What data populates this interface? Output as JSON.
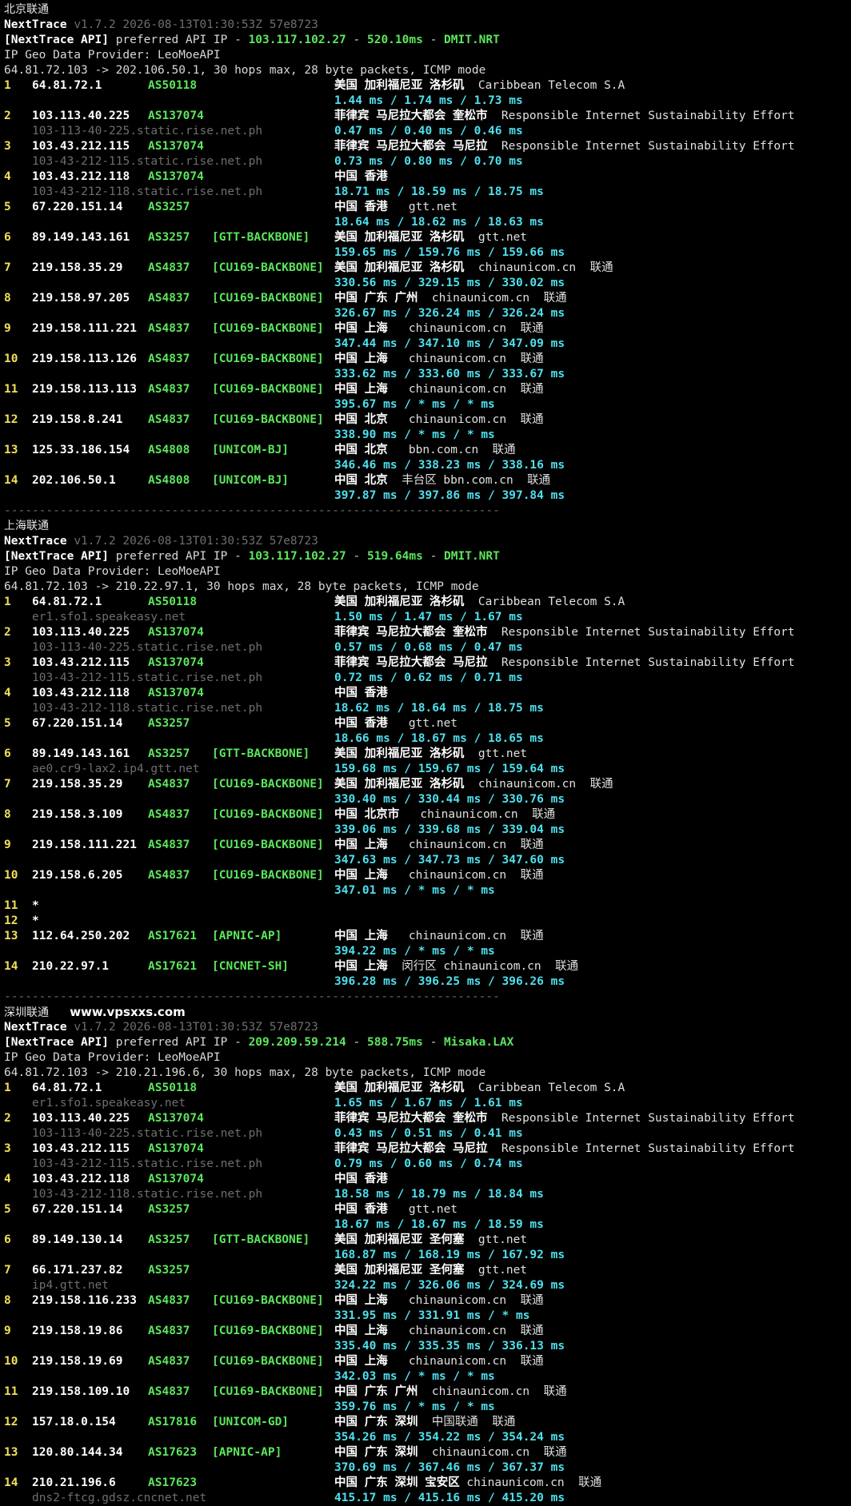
{
  "blocks": [
    {
      "title": "北京联通",
      "watermark": "",
      "header": {
        "brand": "NextTrace",
        "version": "v1.7.2 2026-08-13T01:30:53Z 57e8723",
        "api_label": "[NextTrace API]",
        "api_pref": "preferred API IP -",
        "api_ip": "103.117.102.27",
        "api_dash": "-",
        "api_ms": "520.10ms",
        "api_dc": "DMIT.NRT",
        "geo_provider": "IP Geo Data Provider: LeoMoeAPI",
        "target": "64.81.72.103 -> 202.106.50.1, 30 hops max, 28 byte packets, ICMP mode"
      },
      "hops": [
        {
          "n": "1",
          "ip": "64.81.72.1",
          "as": "AS50118",
          "tag": "",
          "geo": "美国 加利福尼亚 洛杉矶  Caribbean Telecom S.A",
          "rdns": "",
          "rtt": "1.44 ms / 1.74 ms / 1.73 ms"
        },
        {
          "n": "2",
          "ip": "103.113.40.225",
          "as": "AS137074",
          "tag": "",
          "geo": "菲律宾 马尼拉大都会 奎松市  Responsible Internet Sustainability Effort",
          "rdns": "103-113-40-225.static.rise.net.ph",
          "rtt": "0.47 ms / 0.40 ms / 0.46 ms"
        },
        {
          "n": "3",
          "ip": "103.43.212.115",
          "as": "AS137074",
          "tag": "",
          "geo": "菲律宾 马尼拉大都会 马尼拉  Responsible Internet Sustainability Effort",
          "rdns": "103-43-212-115.static.rise.net.ph",
          "rtt": "0.73 ms / 0.80 ms / 0.70 ms"
        },
        {
          "n": "4",
          "ip": "103.43.212.118",
          "as": "AS137074",
          "tag": "",
          "geo": "中国 香港",
          "rdns": "103-43-212-118.static.rise.net.ph",
          "rtt": "18.71 ms / 18.59 ms / 18.75 ms"
        },
        {
          "n": "5",
          "ip": "67.220.151.14",
          "as": "AS3257",
          "tag": "",
          "geo": "中国 香港   gtt.net",
          "rdns": "",
          "rtt": "18.64 ms / 18.62 ms / 18.63 ms"
        },
        {
          "n": "6",
          "ip": "89.149.143.161",
          "as": "AS3257",
          "tag": "[GTT-BACKBONE]",
          "geo": "美国 加利福尼亚 洛杉矶  gtt.net",
          "rdns": "",
          "rtt": "159.65 ms / 159.76 ms / 159.66 ms"
        },
        {
          "n": "7",
          "ip": "219.158.35.29",
          "as": "AS4837",
          "tag": "[CU169-BACKBONE]",
          "geo": "美国 加利福尼亚 洛杉矶  chinaunicom.cn  联通",
          "rdns": "",
          "rtt": "330.56 ms / 329.15 ms / 330.02 ms"
        },
        {
          "n": "8",
          "ip": "219.158.97.205",
          "as": "AS4837",
          "tag": "[CU169-BACKBONE]",
          "geo": "中国 广东 广州  chinaunicom.cn  联通",
          "rdns": "",
          "rtt": "326.67 ms / 326.24 ms / 326.24 ms"
        },
        {
          "n": "9",
          "ip": "219.158.111.221",
          "as": "AS4837",
          "tag": "[CU169-BACKBONE]",
          "geo": "中国 上海   chinaunicom.cn  联通",
          "rdns": "",
          "rtt": "347.44 ms / 347.10 ms / 347.09 ms"
        },
        {
          "n": "10",
          "ip": "219.158.113.126",
          "as": "AS4837",
          "tag": "[CU169-BACKBONE]",
          "geo": "中国 上海   chinaunicom.cn  联通",
          "rdns": "",
          "rtt": "333.62 ms / 333.60 ms / 333.67 ms"
        },
        {
          "n": "11",
          "ip": "219.158.113.113",
          "as": "AS4837",
          "tag": "[CU169-BACKBONE]",
          "geo": "中国 上海   chinaunicom.cn  联通",
          "rdns": "",
          "rtt": "395.67 ms / * ms / * ms"
        },
        {
          "n": "12",
          "ip": "219.158.8.241",
          "as": "AS4837",
          "tag": "[CU169-BACKBONE]",
          "geo": "中国 北京   chinaunicom.cn  联通",
          "rdns": "",
          "rtt": "338.90 ms / * ms / * ms"
        },
        {
          "n": "13",
          "ip": "125.33.186.154",
          "as": "AS4808",
          "tag": "[UNICOM-BJ]",
          "geo": "中国 北京   bbn.com.cn  联通",
          "rdns": "",
          "rtt": "346.46 ms / 338.23 ms / 338.16 ms"
        },
        {
          "n": "14",
          "ip": "202.106.50.1",
          "as": "AS4808",
          "tag": "[UNICOM-BJ]",
          "geo": "中国 北京  丰台区 bbn.com.cn  联通",
          "rdns": "",
          "rtt": "397.87 ms / 397.86 ms / 397.84 ms"
        }
      ],
      "separator": "-----------------------------------------------------------------------"
    },
    {
      "title": "上海联通",
      "watermark": "",
      "header": {
        "brand": "NextTrace",
        "version": "v1.7.2 2026-08-13T01:30:53Z 57e8723",
        "api_label": "[NextTrace API]",
        "api_pref": "preferred API IP -",
        "api_ip": "103.117.102.27",
        "api_dash": "-",
        "api_ms": "519.64ms",
        "api_dc": "DMIT.NRT",
        "geo_provider": "IP Geo Data Provider: LeoMoeAPI",
        "target": "64.81.72.103 -> 210.22.97.1, 30 hops max, 28 byte packets, ICMP mode"
      },
      "hops": [
        {
          "n": "1",
          "ip": "64.81.72.1",
          "as": "AS50118",
          "tag": "",
          "geo": "美国 加利福尼亚 洛杉矶  Caribbean Telecom S.A",
          "rdns": "er1.sfo1.speakeasy.net",
          "rtt": "1.50 ms / 1.47 ms / 1.67 ms"
        },
        {
          "n": "2",
          "ip": "103.113.40.225",
          "as": "AS137074",
          "tag": "",
          "geo": "菲律宾 马尼拉大都会 奎松市  Responsible Internet Sustainability Effort",
          "rdns": "103-113-40-225.static.rise.net.ph",
          "rtt": "0.57 ms / 0.68 ms / 0.47 ms"
        },
        {
          "n": "3",
          "ip": "103.43.212.115",
          "as": "AS137074",
          "tag": "",
          "geo": "菲律宾 马尼拉大都会 马尼拉  Responsible Internet Sustainability Effort",
          "rdns": "103-43-212-115.static.rise.net.ph",
          "rtt": "0.72 ms / 0.62 ms / 0.71 ms"
        },
        {
          "n": "4",
          "ip": "103.43.212.118",
          "as": "AS137074",
          "tag": "",
          "geo": "中国 香港",
          "rdns": "103-43-212-118.static.rise.net.ph",
          "rtt": "18.62 ms / 18.64 ms / 18.75 ms"
        },
        {
          "n": "5",
          "ip": "67.220.151.14",
          "as": "AS3257",
          "tag": "",
          "geo": "中国 香港   gtt.net",
          "rdns": "",
          "rtt": "18.66 ms / 18.67 ms / 18.65 ms"
        },
        {
          "n": "6",
          "ip": "89.149.143.161",
          "as": "AS3257",
          "tag": "[GTT-BACKBONE]",
          "geo": "美国 加利福尼亚 洛杉矶  gtt.net",
          "rdns": "ae0.cr9-lax2.ip4.gtt.net",
          "rtt": "159.68 ms / 159.67 ms / 159.64 ms"
        },
        {
          "n": "7",
          "ip": "219.158.35.29",
          "as": "AS4837",
          "tag": "[CU169-BACKBONE]",
          "geo": "美国 加利福尼亚 洛杉矶  chinaunicom.cn  联通",
          "rdns": "",
          "rtt": "330.40 ms / 330.44 ms / 330.76 ms"
        },
        {
          "n": "8",
          "ip": "219.158.3.109",
          "as": "AS4837",
          "tag": "[CU169-BACKBONE]",
          "geo": "中国 北京市   chinaunicom.cn  联通",
          "rdns": "",
          "rtt": "339.06 ms / 339.68 ms / 339.04 ms"
        },
        {
          "n": "9",
          "ip": "219.158.111.221",
          "as": "AS4837",
          "tag": "[CU169-BACKBONE]",
          "geo": "中国 上海   chinaunicom.cn  联通",
          "rdns": "",
          "rtt": "347.63 ms / 347.73 ms / 347.60 ms"
        },
        {
          "n": "10",
          "ip": "219.158.6.205",
          "as": "AS4837",
          "tag": "[CU169-BACKBONE]",
          "geo": "中国 上海   chinaunicom.cn  联通",
          "rdns": "",
          "rtt": "347.01 ms / * ms / * ms"
        },
        {
          "n": "11",
          "ip": "*",
          "as": "",
          "tag": "",
          "geo": "",
          "rdns": "",
          "rtt": ""
        },
        {
          "n": "12",
          "ip": "*",
          "as": "",
          "tag": "",
          "geo": "",
          "rdns": "",
          "rtt": ""
        },
        {
          "n": "13",
          "ip": "112.64.250.202",
          "as": "AS17621",
          "tag": "[APNIC-AP]",
          "geo": "中国 上海   chinaunicom.cn  联通",
          "rdns": "",
          "rtt": "394.22 ms / * ms / * ms"
        },
        {
          "n": "14",
          "ip": "210.22.97.1",
          "as": "AS17621",
          "tag": "[CNCNET-SH]",
          "geo": "中国 上海  闵行区 chinaunicom.cn  联通",
          "rdns": "",
          "rtt": "396.28 ms / 396.25 ms / 396.26 ms"
        }
      ],
      "separator": "-----------------------------------------------------------------------"
    },
    {
      "title": "深圳联通",
      "watermark": "www.vpsxxs.com",
      "header": {
        "brand": "NextTrace",
        "version": "v1.7.2 2026-08-13T01:30:53Z 57e8723",
        "api_label": "[NextTrace API]",
        "api_pref": "preferred API IP -",
        "api_ip": "209.209.59.214",
        "api_dash": "-",
        "api_ms": "588.75ms",
        "api_dc": "Misaka.LAX",
        "geo_provider": "IP Geo Data Provider: LeoMoeAPI",
        "target": "64.81.72.103 -> 210.21.196.6, 30 hops max, 28 byte packets, ICMP mode"
      },
      "hops": [
        {
          "n": "1",
          "ip": "64.81.72.1",
          "as": "AS50118",
          "tag": "",
          "geo": "美国 加利福尼亚 洛杉矶  Caribbean Telecom S.A",
          "rdns": "er1.sfo1.speakeasy.net",
          "rtt": "1.65 ms / 1.67 ms / 1.61 ms"
        },
        {
          "n": "2",
          "ip": "103.113.40.225",
          "as": "AS137074",
          "tag": "",
          "geo": "菲律宾 马尼拉大都会 奎松市  Responsible Internet Sustainability Effort",
          "rdns": "103-113-40-225.static.rise.net.ph",
          "rtt": "0.43 ms / 0.51 ms / 0.41 ms"
        },
        {
          "n": "3",
          "ip": "103.43.212.115",
          "as": "AS137074",
          "tag": "",
          "geo": "菲律宾 马尼拉大都会 马尼拉  Responsible Internet Sustainability Effort",
          "rdns": "103-43-212-115.static.rise.net.ph",
          "rtt": "0.79 ms / 0.60 ms / 0.74 ms"
        },
        {
          "n": "4",
          "ip": "103.43.212.118",
          "as": "AS137074",
          "tag": "",
          "geo": "中国 香港",
          "rdns": "103-43-212-118.static.rise.net.ph",
          "rtt": "18.58 ms / 18.79 ms / 18.84 ms"
        },
        {
          "n": "5",
          "ip": "67.220.151.14",
          "as": "AS3257",
          "tag": "",
          "geo": "中国 香港   gtt.net",
          "rdns": "",
          "rtt": "18.67 ms / 18.67 ms / 18.59 ms"
        },
        {
          "n": "6",
          "ip": "89.149.130.14",
          "as": "AS3257",
          "tag": "[GTT-BACKBONE]",
          "geo": "美国 加利福尼亚 圣何塞  gtt.net",
          "rdns": "",
          "rtt": "168.87 ms / 168.19 ms / 167.92 ms"
        },
        {
          "n": "7",
          "ip": "66.171.237.82",
          "as": "AS3257",
          "tag": "",
          "geo": "美国 加利福尼亚 圣何塞  gtt.net",
          "rdns": "ip4.gtt.net",
          "rtt": "324.22 ms / 326.06 ms / 324.69 ms"
        },
        {
          "n": "8",
          "ip": "219.158.116.233",
          "as": "AS4837",
          "tag": "[CU169-BACKBONE]",
          "geo": "中国 上海   chinaunicom.cn  联通",
          "rdns": "",
          "rtt": "331.95 ms / 331.91 ms / * ms"
        },
        {
          "n": "9",
          "ip": "219.158.19.86",
          "as": "AS4837",
          "tag": "[CU169-BACKBONE]",
          "geo": "中国 上海   chinaunicom.cn  联通",
          "rdns": "",
          "rtt": "335.40 ms / 335.35 ms / 336.13 ms"
        },
        {
          "n": "10",
          "ip": "219.158.19.69",
          "as": "AS4837",
          "tag": "[CU169-BACKBONE]",
          "geo": "中国 上海   chinaunicom.cn  联通",
          "rdns": "",
          "rtt": "342.03 ms / * ms / * ms"
        },
        {
          "n": "11",
          "ip": "219.158.109.10",
          "as": "AS4837",
          "tag": "[CU169-BACKBONE]",
          "geo": "中国 广东 广州  chinaunicom.cn  联通",
          "rdns": "",
          "rtt": "359.76 ms / * ms / * ms"
        },
        {
          "n": "12",
          "ip": "157.18.0.154",
          "as": "AS17816",
          "tag": "[UNICOM-GD]",
          "geo": "中国 广东 深圳  中国联通  联通",
          "rdns": "",
          "rtt": "354.26 ms / 354.22 ms / 354.24 ms"
        },
        {
          "n": "13",
          "ip": "120.80.144.34",
          "as": "AS17623",
          "tag": "[APNIC-AP]",
          "geo": "中国 广东 深圳  chinaunicom.cn  联通",
          "rdns": "",
          "rtt": "370.69 ms / 367.46 ms / 367.37 ms"
        },
        {
          "n": "14",
          "ip": "210.21.196.6",
          "as": "AS17623",
          "tag": "",
          "geo": "中国 广东 深圳 宝安区 chinaunicom.cn  联通",
          "rdns": "dns2-ftcg.gdsz.cncnet.net",
          "rtt": "415.17 ms / 415.16 ms / 415.20 ms"
        }
      ],
      "separator": ""
    }
  ]
}
